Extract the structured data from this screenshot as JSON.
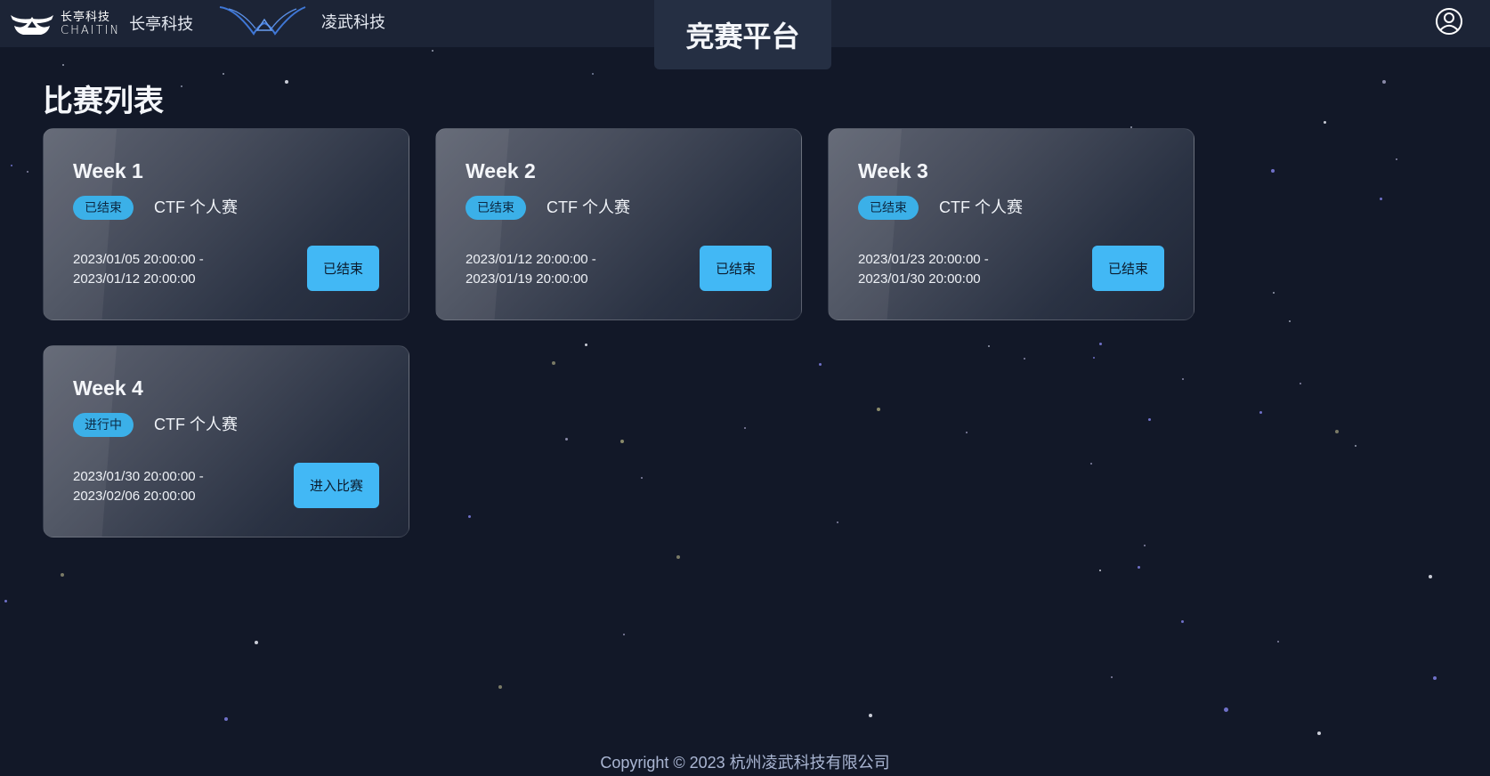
{
  "header": {
    "brand1": {
      "logo_cn": "长亭科技",
      "logo_en": "CHAITIN",
      "name": "长亭科技"
    },
    "brand2": {
      "name": "凌武科技"
    },
    "platform_title": "竞赛平台",
    "user_icon": "user-circle-icon"
  },
  "main": {
    "title": "比赛列表",
    "competitions": [
      {
        "title": "Week 1",
        "status": "已结束",
        "type": "CTF 个人赛",
        "start": "2023/01/05 20:00:00 -",
        "end": "2023/01/12 20:00:00",
        "button": "已结束"
      },
      {
        "title": "Week 2",
        "status": "已结束",
        "type": "CTF 个人赛",
        "start": "2023/01/12 20:00:00 -",
        "end": "2023/01/19 20:00:00",
        "button": "已结束"
      },
      {
        "title": "Week 3",
        "status": "已结束",
        "type": "CTF 个人赛",
        "start": "2023/01/23 20:00:00 -",
        "end": "2023/01/30 20:00:00",
        "button": "已结束"
      },
      {
        "title": "Week 4",
        "status": "进行中",
        "type": "CTF 个人赛",
        "start": "2023/01/30 20:00:00 -",
        "end": "2023/02/06 20:00:00",
        "button": "进入比赛"
      }
    ]
  },
  "footer": {
    "copyright": "Copyright © 2023 杭州凌武科技有限公司"
  },
  "colors": {
    "background": "#121828",
    "header": "#1c2436",
    "accent": "#42b8f5",
    "badge": "#3bb0e8"
  }
}
